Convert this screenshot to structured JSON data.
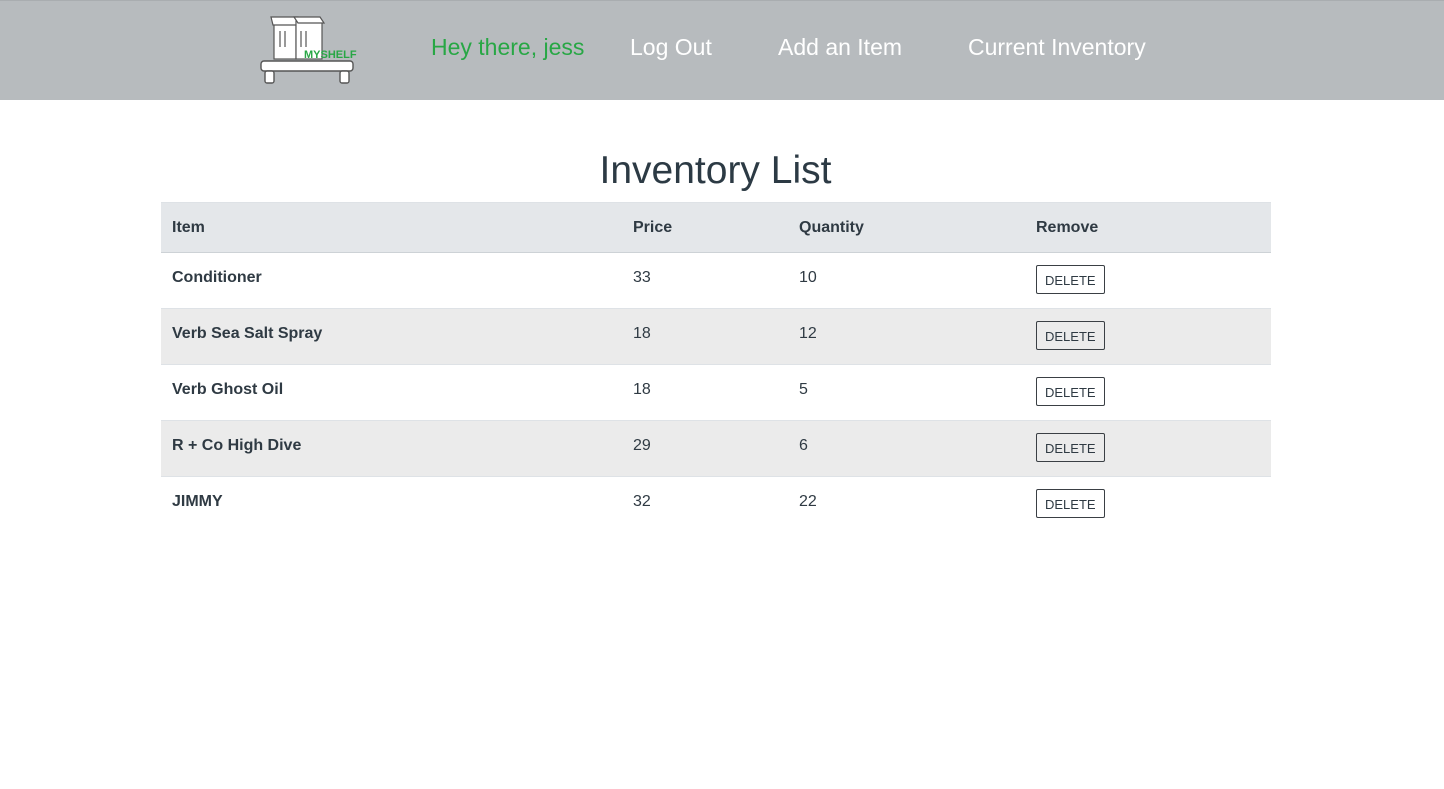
{
  "header": {
    "logo_text": "MYSHELF",
    "greeting": "Hey there, jess",
    "logout_label": "Log Out",
    "add_item_label": "Add an Item",
    "current_inventory_label": "Current Inventory",
    "greeting_color": "#28a745"
  },
  "main": {
    "title": "Inventory List",
    "columns": [
      "Item",
      "Price",
      "Quantity",
      "Remove"
    ],
    "rows": [
      {
        "item": "Conditioner",
        "price": "33",
        "quantity": "10",
        "action": "DELETE"
      },
      {
        "item": "Verb Sea Salt Spray",
        "price": "18",
        "quantity": "12",
        "action": "DELETE"
      },
      {
        "item": "Verb Ghost Oil",
        "price": "18",
        "quantity": "5",
        "action": "DELETE"
      },
      {
        "item": "R + Co High Dive",
        "price": "29",
        "quantity": "6",
        "action": "DELETE"
      },
      {
        "item": "JIMMY",
        "price": "32",
        "quantity": "22",
        "action": "DELETE"
      }
    ]
  },
  "icons": {
    "logo": "shelf-cart-logo-icon"
  }
}
